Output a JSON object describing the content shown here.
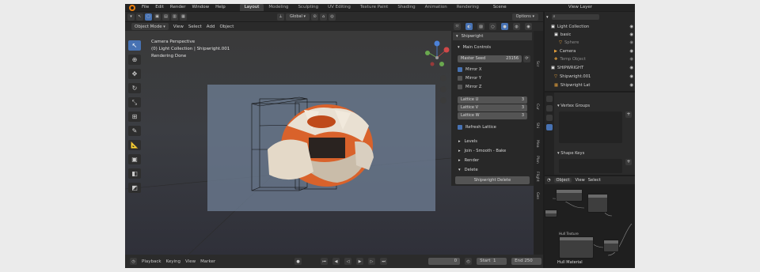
{
  "menu": {
    "items": [
      "File",
      "Edit",
      "Render",
      "Window",
      "Help"
    ]
  },
  "workspace_tabs": [
    "Layout",
    "Modeling",
    "Sculpting",
    "UV Editing",
    "Texture Paint",
    "Shading",
    "Animation",
    "Rendering"
  ],
  "scene_label": "Scene",
  "view_layer_label": "View Layer",
  "toolbar": {
    "transform_orientation": "Global",
    "options_label": "Options"
  },
  "viewport_header": {
    "mode": "Object Mode",
    "menus": [
      "View",
      "Select",
      "Add",
      "Object"
    ]
  },
  "viewport_overlay": {
    "line1": "Camera Perspective",
    "line2": "(0) Light Collection | Shipwright.001",
    "line3": "Rendering Done"
  },
  "npanel": {
    "title": "Shipwright",
    "main_controls": "Main Controls",
    "master_seed_label": "Master Seed",
    "master_seed_value": "23156",
    "mirror_x": "Mirror X",
    "mirror_y": "Mirror Y",
    "mirror_z": "Mirror Z",
    "lattice_u_label": "Lattice U",
    "lattice_u_value": "3",
    "lattice_v_label": "Lattice V",
    "lattice_v_value": "3",
    "lattice_w_label": "Lattice W",
    "lattice_w_value": "3",
    "refresh_lattice": "Refresh Lattice",
    "levels": "Levels",
    "join_smooth": "Join - Smooth - Bake",
    "render": "Render",
    "delete": "Delete",
    "delete_button": "Shipwright Delete"
  },
  "side_tabs": [
    "Scr",
    "Cur",
    "Shi",
    "Mea",
    "Plan",
    "Flight",
    "Gen"
  ],
  "timeline": {
    "menus": [
      "Playback",
      "Keying",
      "View",
      "Marker"
    ],
    "current_frame": "0",
    "start_label": "Start",
    "start_value": "1",
    "end_label": "End",
    "end_value": "250"
  },
  "outliner": {
    "items": [
      "Light Collection",
      "basic",
      "Sphere",
      "Camera",
      "Temp Object",
      "SHIPWRIGHT",
      "Shipwright.001",
      "Shipwright Lat"
    ]
  },
  "properties": {
    "vertex_groups": "Vertex Groups",
    "shape_keys": "Shape Keys"
  },
  "node_editor": {
    "header_mode": "Object",
    "menus": [
      "View",
      "Select"
    ],
    "material_label": "Hull Material",
    "node_title": "Hull Texture"
  },
  "colors": {
    "accent_blue": "#4772b3",
    "active_orange": "#e87d0d",
    "ship_orange": "#d9622b",
    "ship_cream": "#d8cdbb",
    "background": "#ebebeb"
  }
}
